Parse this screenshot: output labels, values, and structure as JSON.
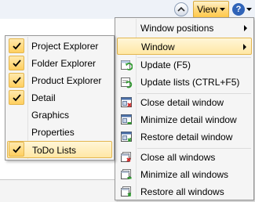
{
  "toolbar": {
    "view_label": "View",
    "help_label": "?"
  },
  "view_menu": {
    "items": [
      {
        "label": "Window positions",
        "has_submenu": true
      },
      {
        "label": "Window",
        "has_submenu": true,
        "highlighted": true
      },
      {
        "label": "Update (F5)",
        "icon": "update-icon"
      },
      {
        "label": "Update lists (CTRL+F5)",
        "icon": "update-lists-icon"
      },
      {
        "label": "Close detail window",
        "icon": "close-detail-window-icon"
      },
      {
        "label": "Minimize detail window",
        "icon": "minimize-detail-window-icon"
      },
      {
        "label": "Restore detail window",
        "icon": "restore-detail-window-icon"
      },
      {
        "label": "Close all windows",
        "icon": "close-all-windows-icon"
      },
      {
        "label": "Minimize all windows",
        "icon": "minimize-all-windows-icon"
      },
      {
        "label": "Restore all windows",
        "icon": "restore-all-windows-icon"
      }
    ]
  },
  "window_submenu": {
    "items": [
      {
        "label": "Project Explorer",
        "checked": true
      },
      {
        "label": "Folder Explorer",
        "checked": true
      },
      {
        "label": "Product Explorer",
        "checked": true
      },
      {
        "label": "Detail",
        "checked": true
      },
      {
        "label": "Graphics",
        "checked": false
      },
      {
        "label": "Properties",
        "checked": false
      },
      {
        "label": "ToDo Lists",
        "checked": true,
        "highlighted": true
      }
    ]
  },
  "colors": {
    "highlight": "#ffe7a4",
    "highlight_border": "#e3b64f",
    "help_blue": "#2f63b8"
  }
}
